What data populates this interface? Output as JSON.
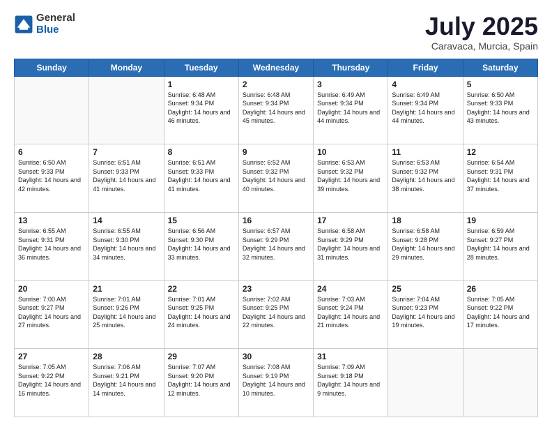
{
  "logo": {
    "general": "General",
    "blue": "Blue"
  },
  "title": "July 2025",
  "location": "Caravaca, Murcia, Spain",
  "headers": [
    "Sunday",
    "Monday",
    "Tuesday",
    "Wednesday",
    "Thursday",
    "Friday",
    "Saturday"
  ],
  "rows": [
    [
      {
        "day": "",
        "text": ""
      },
      {
        "day": "",
        "text": ""
      },
      {
        "day": "1",
        "text": "Sunrise: 6:48 AM\nSunset: 9:34 PM\nDaylight: 14 hours and 46 minutes."
      },
      {
        "day": "2",
        "text": "Sunrise: 6:48 AM\nSunset: 9:34 PM\nDaylight: 14 hours and 45 minutes."
      },
      {
        "day": "3",
        "text": "Sunrise: 6:49 AM\nSunset: 9:34 PM\nDaylight: 14 hours and 44 minutes."
      },
      {
        "day": "4",
        "text": "Sunrise: 6:49 AM\nSunset: 9:34 PM\nDaylight: 14 hours and 44 minutes."
      },
      {
        "day": "5",
        "text": "Sunrise: 6:50 AM\nSunset: 9:33 PM\nDaylight: 14 hours and 43 minutes."
      }
    ],
    [
      {
        "day": "6",
        "text": "Sunrise: 6:50 AM\nSunset: 9:33 PM\nDaylight: 14 hours and 42 minutes."
      },
      {
        "day": "7",
        "text": "Sunrise: 6:51 AM\nSunset: 9:33 PM\nDaylight: 14 hours and 41 minutes."
      },
      {
        "day": "8",
        "text": "Sunrise: 6:51 AM\nSunset: 9:33 PM\nDaylight: 14 hours and 41 minutes."
      },
      {
        "day": "9",
        "text": "Sunrise: 6:52 AM\nSunset: 9:32 PM\nDaylight: 14 hours and 40 minutes."
      },
      {
        "day": "10",
        "text": "Sunrise: 6:53 AM\nSunset: 9:32 PM\nDaylight: 14 hours and 39 minutes."
      },
      {
        "day": "11",
        "text": "Sunrise: 6:53 AM\nSunset: 9:32 PM\nDaylight: 14 hours and 38 minutes."
      },
      {
        "day": "12",
        "text": "Sunrise: 6:54 AM\nSunset: 9:31 PM\nDaylight: 14 hours and 37 minutes."
      }
    ],
    [
      {
        "day": "13",
        "text": "Sunrise: 6:55 AM\nSunset: 9:31 PM\nDaylight: 14 hours and 36 minutes."
      },
      {
        "day": "14",
        "text": "Sunrise: 6:55 AM\nSunset: 9:30 PM\nDaylight: 14 hours and 34 minutes."
      },
      {
        "day": "15",
        "text": "Sunrise: 6:56 AM\nSunset: 9:30 PM\nDaylight: 14 hours and 33 minutes."
      },
      {
        "day": "16",
        "text": "Sunrise: 6:57 AM\nSunset: 9:29 PM\nDaylight: 14 hours and 32 minutes."
      },
      {
        "day": "17",
        "text": "Sunrise: 6:58 AM\nSunset: 9:29 PM\nDaylight: 14 hours and 31 minutes."
      },
      {
        "day": "18",
        "text": "Sunrise: 6:58 AM\nSunset: 9:28 PM\nDaylight: 14 hours and 29 minutes."
      },
      {
        "day": "19",
        "text": "Sunrise: 6:59 AM\nSunset: 9:27 PM\nDaylight: 14 hours and 28 minutes."
      }
    ],
    [
      {
        "day": "20",
        "text": "Sunrise: 7:00 AM\nSunset: 9:27 PM\nDaylight: 14 hours and 27 minutes."
      },
      {
        "day": "21",
        "text": "Sunrise: 7:01 AM\nSunset: 9:26 PM\nDaylight: 14 hours and 25 minutes."
      },
      {
        "day": "22",
        "text": "Sunrise: 7:01 AM\nSunset: 9:25 PM\nDaylight: 14 hours and 24 minutes."
      },
      {
        "day": "23",
        "text": "Sunrise: 7:02 AM\nSunset: 9:25 PM\nDaylight: 14 hours and 22 minutes."
      },
      {
        "day": "24",
        "text": "Sunrise: 7:03 AM\nSunset: 9:24 PM\nDaylight: 14 hours and 21 minutes."
      },
      {
        "day": "25",
        "text": "Sunrise: 7:04 AM\nSunset: 9:23 PM\nDaylight: 14 hours and 19 minutes."
      },
      {
        "day": "26",
        "text": "Sunrise: 7:05 AM\nSunset: 9:22 PM\nDaylight: 14 hours and 17 minutes."
      }
    ],
    [
      {
        "day": "27",
        "text": "Sunrise: 7:05 AM\nSunset: 9:22 PM\nDaylight: 14 hours and 16 minutes."
      },
      {
        "day": "28",
        "text": "Sunrise: 7:06 AM\nSunset: 9:21 PM\nDaylight: 14 hours and 14 minutes."
      },
      {
        "day": "29",
        "text": "Sunrise: 7:07 AM\nSunset: 9:20 PM\nDaylight: 14 hours and 12 minutes."
      },
      {
        "day": "30",
        "text": "Sunrise: 7:08 AM\nSunset: 9:19 PM\nDaylight: 14 hours and 10 minutes."
      },
      {
        "day": "31",
        "text": "Sunrise: 7:09 AM\nSunset: 9:18 PM\nDaylight: 14 hours and 9 minutes."
      },
      {
        "day": "",
        "text": ""
      },
      {
        "day": "",
        "text": ""
      }
    ]
  ]
}
